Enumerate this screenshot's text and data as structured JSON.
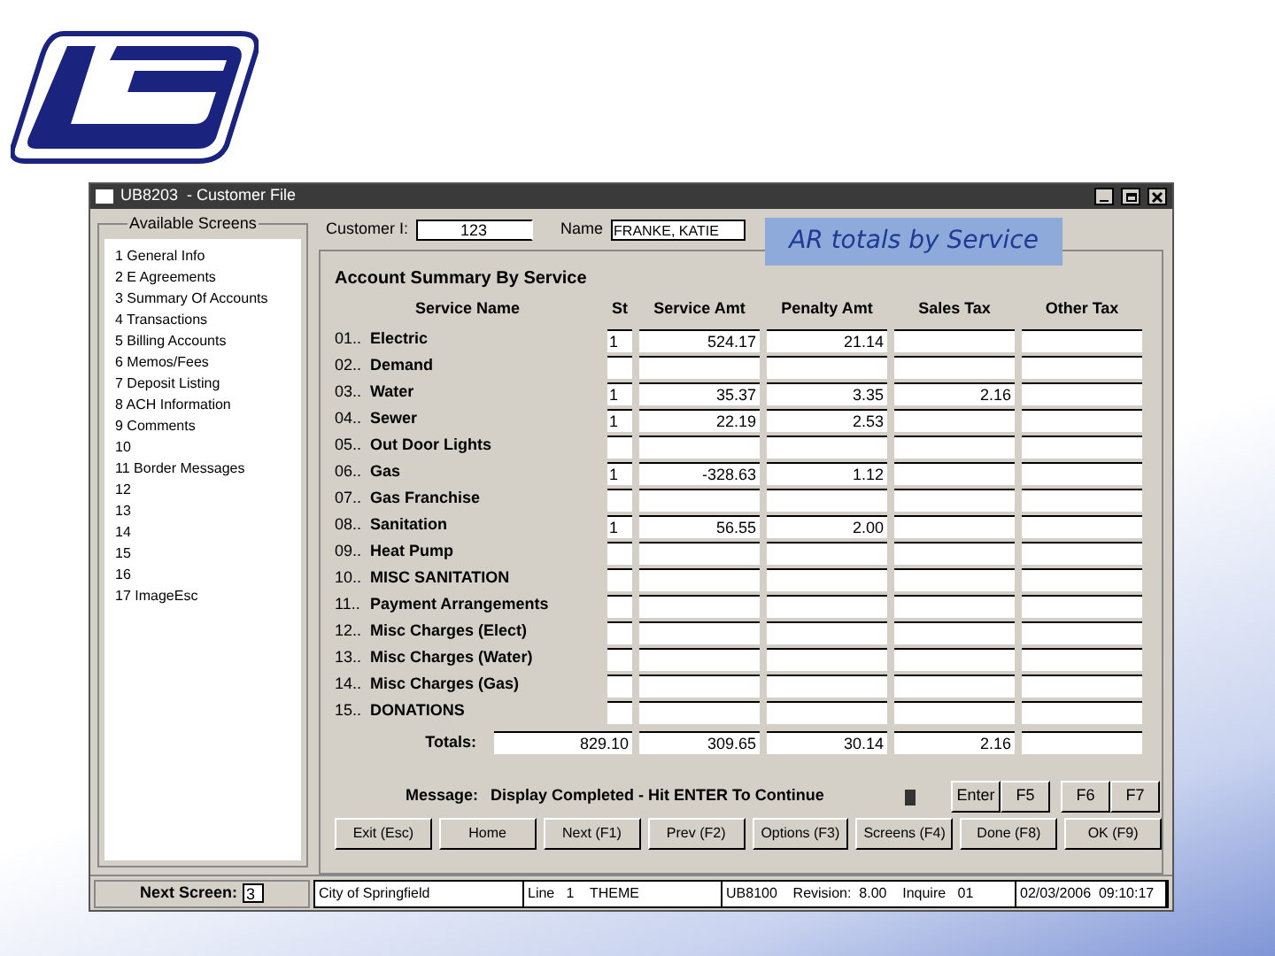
{
  "callout": "AR totals by Service",
  "window": {
    "title": "UB8203  - Customer File"
  },
  "sidebar": {
    "title": "Available Screens",
    "items": [
      {
        "label": "1 General Info"
      },
      {
        "label": "2 E Agreements"
      },
      {
        "label": "3 Summary Of Accounts"
      },
      {
        "label": "4 Transactions"
      },
      {
        "label": "5 Billing Accounts"
      },
      {
        "label": "6 Memos/Fees"
      },
      {
        "label": "7 Deposit Listing"
      },
      {
        "label": "8 ACH Information"
      },
      {
        "label": "9 Comments"
      },
      {
        "label": "10"
      },
      {
        "label": "11 Border Messages"
      },
      {
        "label": "12"
      },
      {
        "label": "13"
      },
      {
        "label": "14"
      },
      {
        "label": "15"
      },
      {
        "label": "16"
      },
      {
        "label": "17 ImageEsc"
      }
    ]
  },
  "header": {
    "customer_label": "Customer I:",
    "customer_value": "123",
    "name_label": "Name",
    "name_value": "FRANKE, KATIE"
  },
  "summary": {
    "title": "Account Summary By Service",
    "columns": [
      "Service Name",
      "St",
      "Service Amt",
      "Penalty Amt",
      "Sales Tax",
      "Other Tax"
    ],
    "rows": [
      {
        "num": "01..",
        "name": "Electric",
        "st": "1",
        "service": "524.17",
        "penalty": "21.14",
        "sales": "",
        "other": ""
      },
      {
        "num": "02..",
        "name": "Demand",
        "st": "",
        "service": "",
        "penalty": "",
        "sales": "",
        "other": ""
      },
      {
        "num": "03..",
        "name": "Water",
        "st": "1",
        "service": "35.37",
        "penalty": "3.35",
        "sales": "2.16",
        "other": ""
      },
      {
        "num": "04..",
        "name": "Sewer",
        "st": "1",
        "service": "22.19",
        "penalty": "2.53",
        "sales": "",
        "other": ""
      },
      {
        "num": "05..",
        "name": "Out Door Lights",
        "st": "",
        "service": "",
        "penalty": "",
        "sales": "",
        "other": ""
      },
      {
        "num": "06..",
        "name": "Gas",
        "st": "1",
        "service": "-328.63",
        "penalty": "1.12",
        "sales": "",
        "other": ""
      },
      {
        "num": "07..",
        "name": "Gas Franchise",
        "st": "",
        "service": "",
        "penalty": "",
        "sales": "",
        "other": ""
      },
      {
        "num": "08..",
        "name": "Sanitation",
        "st": "1",
        "service": "56.55",
        "penalty": "2.00",
        "sales": "",
        "other": ""
      },
      {
        "num": "09..",
        "name": "Heat Pump",
        "st": "",
        "service": "",
        "penalty": "",
        "sales": "",
        "other": ""
      },
      {
        "num": "10..",
        "name": "MISC SANITATION",
        "st": "",
        "service": "",
        "penalty": "",
        "sales": "",
        "other": ""
      },
      {
        "num": "11..",
        "name": "Payment Arrangements",
        "st": "",
        "service": "",
        "penalty": "",
        "sales": "",
        "other": ""
      },
      {
        "num": "12..",
        "name": "Misc Charges (Elect)",
        "st": "",
        "service": "",
        "penalty": "",
        "sales": "",
        "other": ""
      },
      {
        "num": "13..",
        "name": "Misc Charges (Water)",
        "st": "",
        "service": "",
        "penalty": "",
        "sales": "",
        "other": ""
      },
      {
        "num": "14..",
        "name": "Misc Charges (Gas)",
        "st": "",
        "service": "",
        "penalty": "",
        "sales": "",
        "other": ""
      },
      {
        "num": "15..",
        "name": "DONATIONS",
        "st": "",
        "service": "",
        "penalty": "",
        "sales": "",
        "other": ""
      }
    ],
    "totals": {
      "label": "Totals:",
      "count": "829.10",
      "service": "309.65",
      "penalty": "30.14",
      "sales": "2.16"
    }
  },
  "message": {
    "label": "Message:",
    "text": "Display Completed - Hit ENTER To Continue"
  },
  "keys": [
    "Enter",
    "F5",
    "F6",
    "F7"
  ],
  "buttons": [
    "Exit (Esc)",
    "Home",
    "Next (F1)",
    "Prev (F2)",
    "Options (F3)",
    "Screens (F4)",
    "Done (F8)",
    "OK (F9)"
  ],
  "status_bar": {
    "next_label": "Next Screen:",
    "next_value": "3",
    "cells": [
      "City of Springfield",
      "Line   1    THEME",
      "UB8100    Revision:  8.00    Inquire   01",
      "02/03/2006  09:10:17"
    ]
  }
}
